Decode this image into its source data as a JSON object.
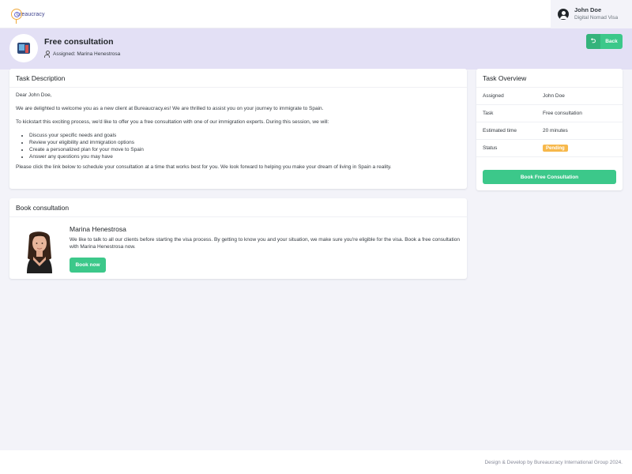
{
  "topbar": {
    "logo_text": "ureaucracy",
    "user_name": "John Doe",
    "user_subtitle": "Digital Nomad Visa"
  },
  "header": {
    "title": "Free consultation",
    "assigned_label": "Assigned: Marina Henestrosa",
    "back_label": "Back"
  },
  "description": {
    "heading": "Task Description",
    "greeting": "Dear John Doe,",
    "intro": "We are delighted to welcome you as a new client at Bureaucracy.es! We are thrilled to assist you on your journey to immigrate to Spain.",
    "lead": "To kickstart this exciting process, we'd like to offer you a free consultation with one of our immigration experts. During this session, we will:",
    "items": [
      "Discuss your specific needs and goals",
      "Review your eligibility and immigration options",
      "Create a personalized plan for your move to Spain",
      "Answer any questions you may have"
    ],
    "closing": "Please click the link below to schedule your consultation at a time that works best for you. We look forward to helping you make your dream of living in Spain a reality."
  },
  "booking": {
    "heading": "Book consultation",
    "consultant_name": "Marina Henestrosa",
    "text": "We like to talk to all our clients before starting the visa process. By getting to know you and your situation, we make sure you're eligible for the visa. Book a free consultation with Marina Henestrosa now.",
    "button_label": "Book now"
  },
  "overview": {
    "heading": "Task Overview",
    "rows": [
      {
        "key": "Assigned",
        "value": "John Doe"
      },
      {
        "key": "Task",
        "value": "Free consultation"
      },
      {
        "key": "Estimated time",
        "value": "20 minutes"
      },
      {
        "key": "Status",
        "value": "Pending"
      }
    ],
    "button_label": "Book Free Consultation"
  },
  "footer": {
    "text": "Design & Develop by Bureaucracy International Group 2024."
  },
  "colors": {
    "accent_green": "#3cc88a",
    "header_band": "#e3e0f5",
    "status_pending": "#f7b84b"
  }
}
